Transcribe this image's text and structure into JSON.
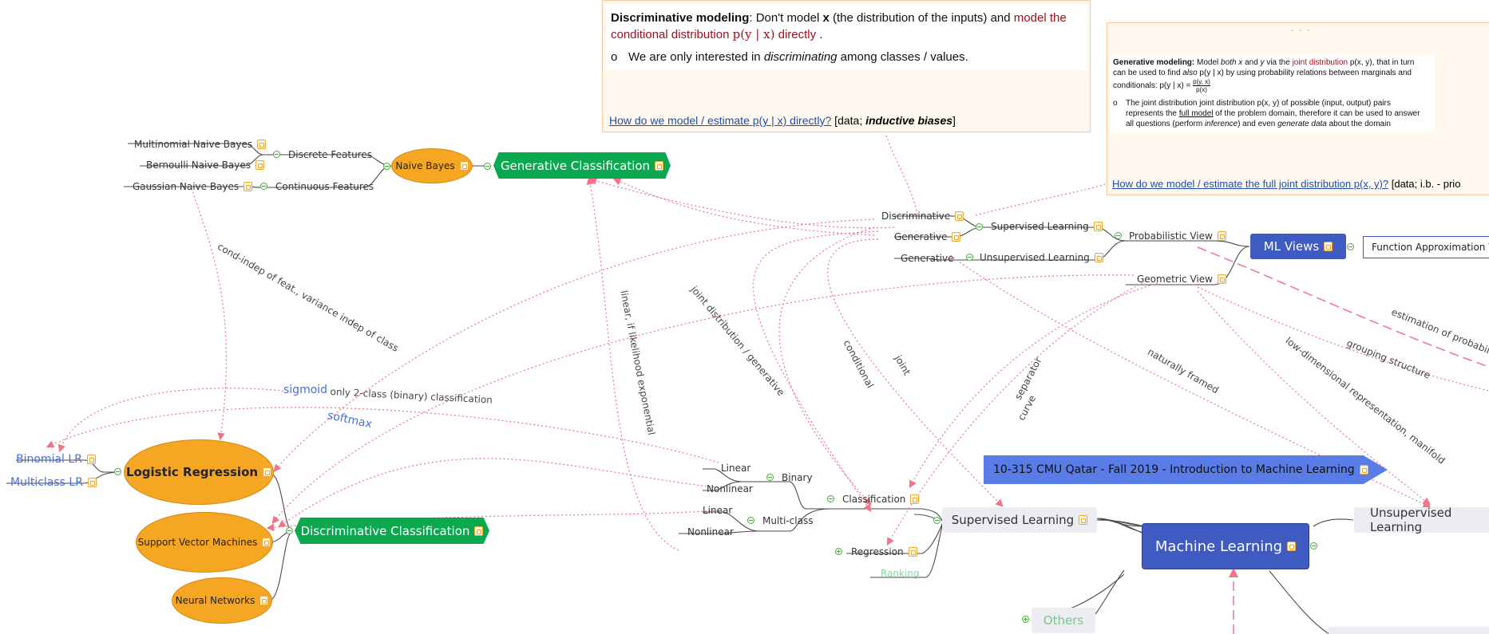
{
  "root": "Machine Learning",
  "course_banner": "10-315 CMU Qatar - Fall 2019 - Introduction to Machine Learning",
  "ml_views": {
    "label": "ML Views",
    "probabilistic_view": "Probabilistic View",
    "geometric_view": "Geometric View",
    "function_approx_view": "Function Approximation Vie",
    "supervised_learning": "Supervised Learning",
    "unsupervised_learning": "Unsupervised Learning",
    "discriminative": "Discriminative",
    "generative_1": "Generative",
    "generative_2": "Generative"
  },
  "main_branches": {
    "supervised_learning": "Supervised Learning",
    "unsupervised_learning": "Unsupervised Learning",
    "others": "Others"
  },
  "supervised": {
    "classification": "Classification",
    "regression": "Regression",
    "ranking": "Ranking",
    "binary": "Binary",
    "multi_class": "Multi-class",
    "linear_1": "Linear",
    "nonlinear_1": "Nonlinear",
    "linear_2": "Linear",
    "nonlinear_2": "Nonlinear"
  },
  "generative_classification": {
    "label": "Generative Classification",
    "naive_bayes": "Naive Bayes",
    "discrete_features": "Discrete Features",
    "continuous_features": "Continuous Features",
    "multinomial_nb": "Multinomial Naive Bayes",
    "bernoulli_nb": "Bernoulli Naive Bayes",
    "gaussian_nb": "Gaussian Naive Bayes"
  },
  "discriminative_classification": {
    "label": "Discriminative Classification",
    "logistic_regression": "Logistic Regression",
    "svm": "Support Vector Machines",
    "neural_networks": "Neural Networks",
    "binomial_lr": "Binomial LR",
    "multiclass_lr": "Multiclass LR"
  },
  "relations": {
    "cond_indep": "cond-indep of feat., variance indep of class",
    "sigmoid": "sigmoid",
    "only_2_class": "only 2-class (binary) classification",
    "softmax": "softmax",
    "linear_if_exp": "linear, if likelihood exponential",
    "joint_generative": "joint distribution / generative",
    "conditional": "conditional",
    "joint": "joint",
    "separator_curve_1": "separator",
    "separator_curve_2": "curve",
    "naturally_framed": "naturally framed",
    "estimation_prob": "estimation of probability",
    "grouping_structure": "grouping structure",
    "low_dim": "low-dimensional representation, manifold"
  },
  "note_discriminative": {
    "title": "Discriminative modeling",
    "text1": ": Don't model ",
    "x_symbol": "x",
    "text2": " (the distribution of the inputs) and ",
    "highlight1": "model the",
    "highlight2": "conditional distribution ",
    "highlight_math": "p(y | x)",
    "highlight3": " directly",
    "text_end": " .",
    "bullet": "We are only interested in ",
    "bullet_em": "discriminating",
    "bullet_end": " among classes / values.",
    "question": "How do we model / estimate p(y | x) directly?",
    "bracket_pre": " [data; ",
    "bracket_em": "inductive biases",
    "bracket_post": "]"
  },
  "note_generative": {
    "title": "Generative modeling:",
    "line1a": " Model ",
    "line1b": "both x",
    "line1c": " and ",
    "line1d": "y",
    "line1e": " via the ",
    "line1f": "joint distribution",
    "line1g": " p(x, y), that in turn",
    "line2a": "can be used to find ",
    "line2b": "also",
    "line2c": " p(y | x) by using probability relations between marginals and",
    "line3a": "conditionals: p(y | x) = ",
    "frac_num": "p(y, x)",
    "frac_den": "p(x)",
    "bullet1": "The joint distribution joint distribution p(x, y) of possible (input, output) pairs",
    "bullet2a": "represents the ",
    "bullet2b": "full model",
    "bullet2c": " of the problem domain, therefore it  can be used to answer",
    "bullet3a": "all questions (perform ",
    "bullet3b": "inference",
    "bullet3c": ")  and even ",
    "bullet3d": "generate data",
    "bullet3e": " about the domain",
    "question": "How do we model / estimate the full joint distribution p(x, y)?",
    "bracket": "  [data; i.b. - prio"
  },
  "colors": {
    "green_node": "#0aa84f",
    "blue_node": "#3f5ac0",
    "orange_node": "#f5a623",
    "gray_node": "#ecedf3",
    "relation_line": "#f0738a",
    "connector": "#4a4a4a",
    "maroon_text": "#a00f1e",
    "link_blue": "#1f4fa8"
  },
  "icons": [
    "note-icon",
    "collapse-toggle-icon",
    "expand-toggle-icon"
  ]
}
